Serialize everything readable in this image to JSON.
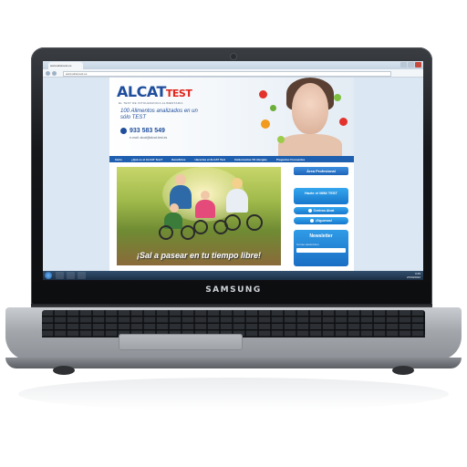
{
  "device": {
    "brand": "SAMSUNG"
  },
  "browser": {
    "tab_title": "www.alcat-test.es",
    "url": "www.alcat-test.es"
  },
  "site": {
    "logo_main": "ALCAT",
    "logo_accent": "TEST",
    "tagline": "EL TEST DE INTOLERANCIA ALIMENTARIA",
    "slogan": "100 Alimentos analizados en un sólo TEST",
    "phone": "933 583 549",
    "email": "e-mail: alcat@alcat-test.es",
    "nav": [
      "Inicio",
      "¿Qué es el ALCAT Test?",
      "Beneficios",
      "Hacerme el ALCAT Test",
      "Intolerancias VS Alergias",
      "Preguntas Frecuentes"
    ],
    "hero_caption": "¡Sal a pasear en tu tiempo libre!",
    "sidebar": {
      "pro_button": "Área Profesional",
      "mini_test": "Hazte el MINI TEST",
      "centers": "Centros Alcat",
      "subscribe": "¡Síguenos!",
      "newsletter_title": "Newsletter",
      "newsletter_label": "Correo electrónico"
    }
  },
  "taskbar": {
    "time": "0:45",
    "date": "27/03/2012"
  }
}
